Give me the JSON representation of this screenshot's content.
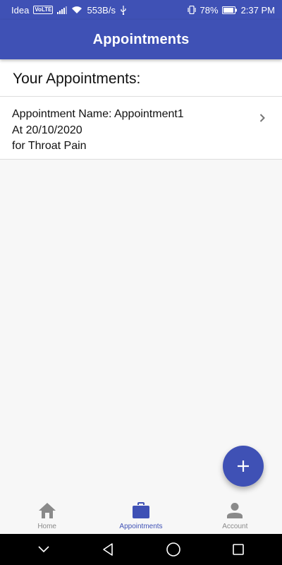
{
  "status_bar": {
    "carrier": "Idea",
    "volte": "VoLTE",
    "speed": "553B/s",
    "battery": "78%",
    "time": "2:37 PM"
  },
  "app_bar": {
    "title": "Appointments"
  },
  "list": {
    "header": "Your Appointments:",
    "items": [
      {
        "name_line": "Appointment Name: Appointment1",
        "date_line": "At 20/10/2020",
        "reason_line": "for Throat Pain"
      }
    ]
  },
  "fab": {
    "icon": "plus-icon"
  },
  "bottom_nav": {
    "tabs": [
      {
        "label": "Home",
        "icon": "home-icon",
        "active": false
      },
      {
        "label": "Appointments",
        "icon": "briefcase-icon",
        "active": true
      },
      {
        "label": "Account",
        "icon": "person-icon",
        "active": false
      }
    ]
  },
  "system_nav": {
    "buttons": [
      "chevron-down-icon",
      "back-icon",
      "home-circle-icon",
      "recents-icon"
    ]
  },
  "colors": {
    "primary": "#3f51b5",
    "inactive": "#8a8a8a",
    "background": "#f7f7f7"
  }
}
